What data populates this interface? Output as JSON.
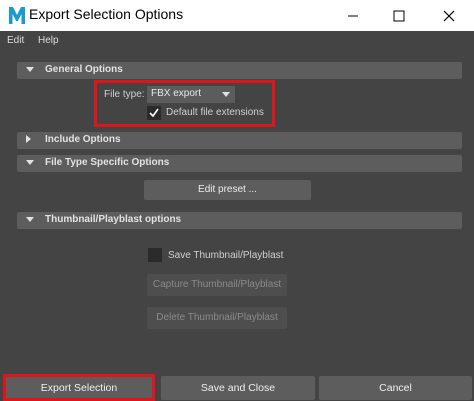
{
  "window": {
    "title": "Export Selection Options",
    "app_icon": "maya-logo"
  },
  "menu": {
    "items": [
      "Edit",
      "Help"
    ]
  },
  "sections": {
    "general": {
      "label": "General Options",
      "expanded": true
    },
    "include": {
      "label": "Include Options",
      "expanded": false
    },
    "file_type_specific": {
      "label": "File Type Specific Options",
      "expanded": true
    },
    "thumbnail": {
      "label": "Thumbnail/Playblast options",
      "expanded": true
    }
  },
  "general_options": {
    "file_type_label": "File type:",
    "file_type_value": "FBX export",
    "default_extensions_label": "Default file extensions",
    "default_extensions_checked": true
  },
  "file_type_specific": {
    "edit_preset_label": "Edit preset ..."
  },
  "thumbnail_options": {
    "save_thumbnail_label": "Save Thumbnail/Playblast",
    "save_thumbnail_checked": false,
    "capture_label": "Capture Thumbnail/Playblast",
    "delete_label": "Delete Thumbnail/Playblast"
  },
  "footer": {
    "export_label": "Export Selection",
    "save_close_label": "Save and Close",
    "cancel_label": "Cancel"
  },
  "colors": {
    "highlight": "#e0141b",
    "background": "#444444",
    "section_header": "#5d5d5d"
  }
}
